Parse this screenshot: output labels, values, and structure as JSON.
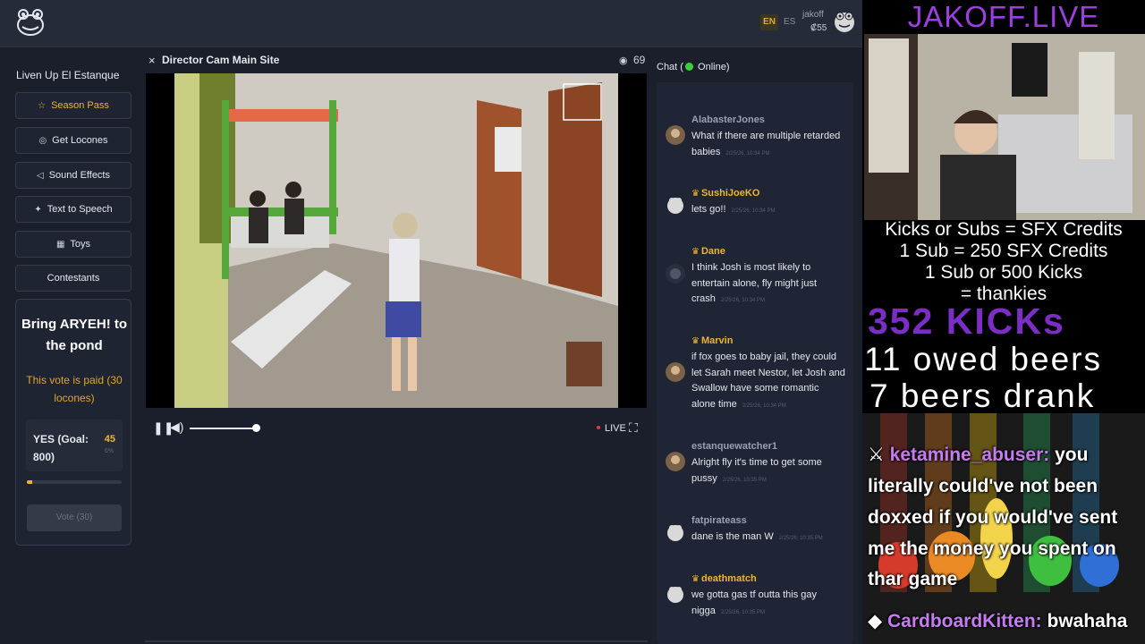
{
  "header": {
    "lang_en": "EN",
    "lang_es": "ES",
    "username": "jakoff",
    "balance": "₡55"
  },
  "sidebar": {
    "title": "Liven Up El Estanque",
    "buttons": [
      {
        "label": "Season Pass",
        "icon": "star-icon"
      },
      {
        "label": "Get Locones",
        "icon": "coin-icon"
      },
      {
        "label": "Sound Effects",
        "icon": "speaker-icon"
      },
      {
        "label": "Text to Speech",
        "icon": "sparkle-icon"
      },
      {
        "label": "Toys",
        "icon": "gift-icon"
      },
      {
        "label": "Contestants",
        "icon": ""
      }
    ],
    "vote": {
      "title": "Bring ARYEH! to the pond",
      "paid_note": "This vote is paid (30 locones)",
      "option_label": "YES (Goal: 800)",
      "count": "45",
      "pct": "6%",
      "progress": 0.06,
      "button_label": "Vote (30)"
    }
  },
  "video": {
    "close": "×",
    "title": "Director Cam Main Site",
    "viewers": "69",
    "live_label": "LIVE"
  },
  "chat": {
    "label_prefix": "Chat (",
    "label_suffix": " Online)",
    "messages": [
      {
        "user": "AlabasterJones",
        "vip": false,
        "text": "What if there are multiple retarded babies",
        "time": "2/25/26, 10:34 PM"
      },
      {
        "user": "SushiJoeKO",
        "vip": true,
        "text": "lets go!!",
        "time": "2/25/26, 10:34 PM"
      },
      {
        "user": "Dane",
        "vip": true,
        "text": "I think Josh is most likely to entertain alone, fly might just crash",
        "time": "2/25/26, 10:34 PM"
      },
      {
        "user": "Marvin",
        "vip": true,
        "text": "if fox goes to baby jail, they could let Sarah meet Nestor, let Josh and Swallow have some romantic alone time",
        "time": "2/25/26, 10:34 PM"
      },
      {
        "user": "estanquewatcher1",
        "vip": false,
        "text": "Alright fly it's time to get some pussy",
        "time": "2/25/26, 10:35 PM"
      },
      {
        "user": "fatpirateass",
        "vip": false,
        "text": "dane is the man W",
        "time": "2/25/26, 10:35 PM"
      },
      {
        "user": "deathmatch",
        "vip": true,
        "text": "we gotta gas tf outta this gay nigga",
        "time": "2/25/26, 10:35 PM"
      }
    ]
  },
  "overlay": {
    "title": "JAKOFF.LIVE",
    "lines": [
      "Kicks or Subs = SFX Credits",
      "1 Sub = 250 SFX Credits",
      "1 Sub or 500 Kicks",
      "= thankies"
    ],
    "kicks": "352 KICKs",
    "beers_owed": "11 owed beers",
    "beers_drank": "7 beers drank",
    "chat": [
      {
        "user": "ketamine_abuser:",
        "text": " you"
      },
      {
        "user": "",
        "text": "literally could've not been"
      },
      {
        "user": "",
        "text": "doxxed if you would've sent"
      },
      {
        "user": "",
        "text": "me the money you spent on"
      },
      {
        "user": "",
        "text": "thar game"
      },
      {
        "user": "CardboardKitten:",
        "text": " bwahaha"
      }
    ]
  },
  "colors": {
    "accent": "#f0b429",
    "online": "#3ad13a",
    "live": "#e03b3b",
    "overlay_purple": "#9b3fe0"
  }
}
